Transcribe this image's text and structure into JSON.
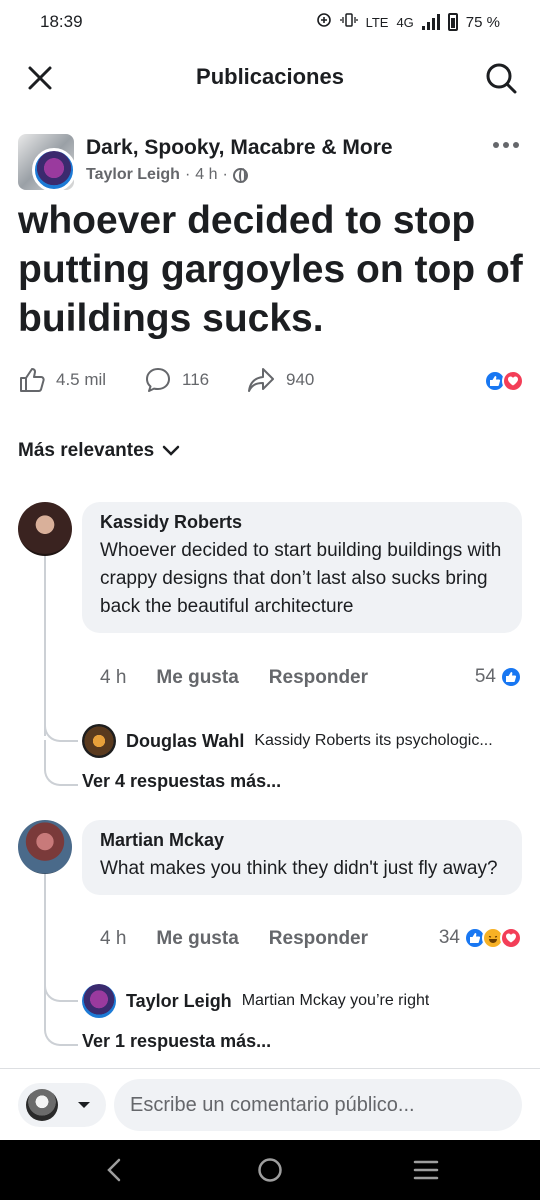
{
  "status_bar": {
    "time": "18:39",
    "network": "4G",
    "volte": "LTE",
    "battery": "75 %"
  },
  "header": {
    "title": "Publicaciones",
    "close_icon": "close-icon",
    "search_icon": "search-icon"
  },
  "post": {
    "group_name": "Dark, Spooky, Macabre & More",
    "author": "Taylor Leigh",
    "time": "4 h",
    "separator": "·",
    "text": "whoever decided to stop putting gargoyles on top of buildings sucks.",
    "likes": "4.5 mil",
    "comments": "116",
    "shares": "940"
  },
  "sort": {
    "label": "Más relevantes"
  },
  "comments": [
    {
      "name": "Kassidy Roberts",
      "text": "Whoever decided to start building buildings with crappy designs that don’t last also sucks bring back the beautiful architecture",
      "time": "4 h",
      "like_label": "Me gusta",
      "reply_label": "Responder",
      "reaction_count": "54",
      "reply_preview": {
        "name": "Douglas Wahl",
        "text": "Kassidy Roberts its psychologic..."
      },
      "more_replies": "Ver 4 respuestas más..."
    },
    {
      "name": "Martian Mckay",
      "text": "What makes you think they didn't just fly away?",
      "time": "4 h",
      "like_label": "Me gusta",
      "reply_label": "Responder",
      "reaction_count": "34",
      "reply_preview": {
        "name": "Taylor Leigh",
        "text": "Martian Mckay you’re right"
      },
      "more_replies": "Ver 1 respuesta más..."
    }
  ],
  "composer": {
    "placeholder": "Escribe un comentario público..."
  },
  "colors": {
    "facebook_blue": "#1877f2",
    "love_red": "#f33e58",
    "haha_yellow": "#f7b125",
    "bubble_gray": "#f0f2f5",
    "secondary_text": "#65676b"
  }
}
